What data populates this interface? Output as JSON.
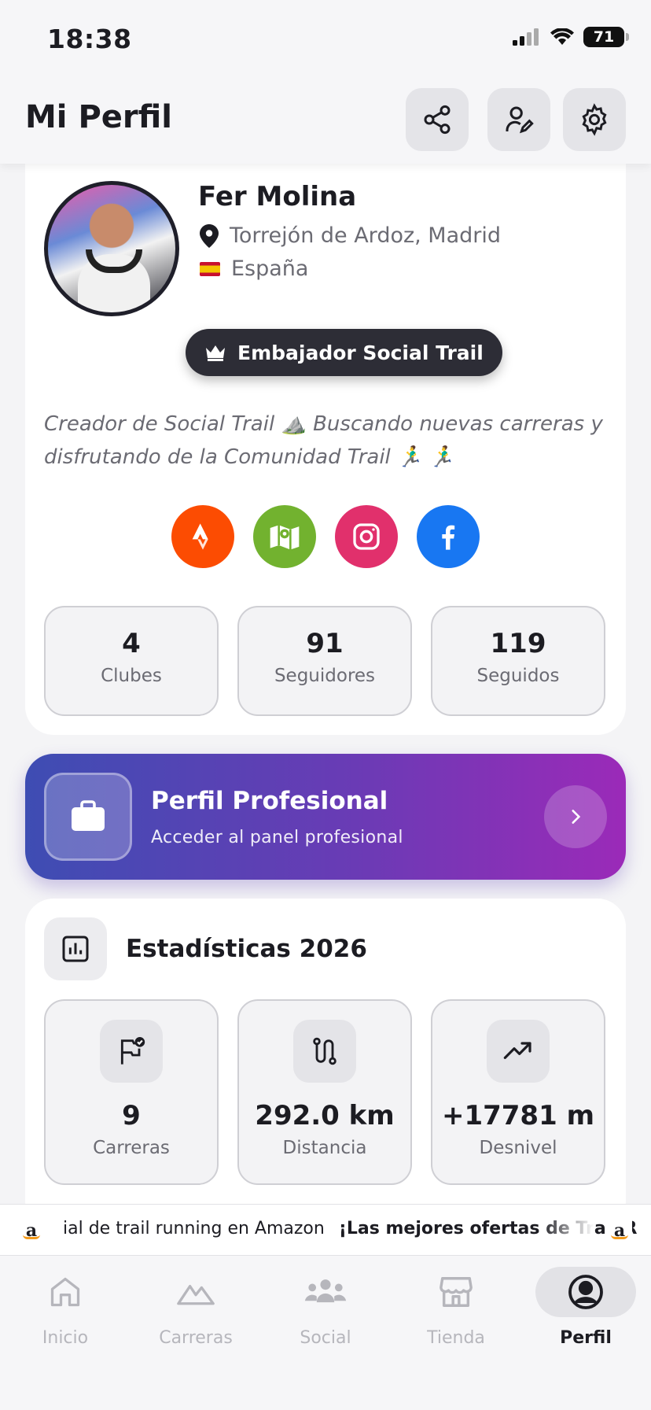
{
  "status_bar": {
    "time": "18:38",
    "battery": "71"
  },
  "header": {
    "title": "Mi Perfil"
  },
  "profile": {
    "name": "Fer Molina",
    "location": "Torrejón de Ardoz, Madrid",
    "country": "España",
    "badge": "Embajador Social Trail",
    "bio": "Creador de Social Trail ⛰️  Buscando nuevas carreras y disfrutando de la Comunidad Trail 🏃‍♂️ 🏃‍♂️",
    "socials": [
      {
        "icon": "strava-icon",
        "color": "#fc4c02"
      },
      {
        "icon": "wikiloc-map-icon",
        "color": "#72b22f"
      },
      {
        "icon": "instagram-icon",
        "color": "#e1306c"
      },
      {
        "icon": "facebook-icon",
        "color": "#1877f2"
      }
    ],
    "counts": [
      {
        "value": "4",
        "label": "Clubes"
      },
      {
        "value": "91",
        "label": "Seguidores"
      },
      {
        "value": "119",
        "label": "Seguidos"
      }
    ]
  },
  "pro_panel": {
    "title": "Perfil Profesional",
    "subtitle": "Acceder al panel profesional"
  },
  "stats": {
    "title": "Estadísticas 2026",
    "items": [
      {
        "value": "9",
        "label": "Carreras",
        "icon": "flag-check-icon"
      },
      {
        "value": "292.0 km",
        "label": "Distancia",
        "icon": "route-icon"
      },
      {
        "value": "+17781 m",
        "label": "Desnivel",
        "icon": "trending-up-icon"
      }
    ]
  },
  "ticker": {
    "text_a": "ial de trail running en Amazon",
    "text_b": "¡Las mejores ofertas de Trail R",
    "logo": "a"
  },
  "tabs": [
    {
      "label": "Inicio",
      "icon": "home-icon"
    },
    {
      "label": "Carreras",
      "icon": "mountain-icon"
    },
    {
      "label": "Social",
      "icon": "people-icon"
    },
    {
      "label": "Tienda",
      "icon": "store-icon"
    },
    {
      "label": "Perfil",
      "icon": "profile-icon",
      "active": true
    }
  ],
  "colors": {
    "accent_gradient_start": "#3e4db3",
    "accent_gradient_end": "#9b2ab8",
    "badge_bg": "#2d2d36"
  }
}
